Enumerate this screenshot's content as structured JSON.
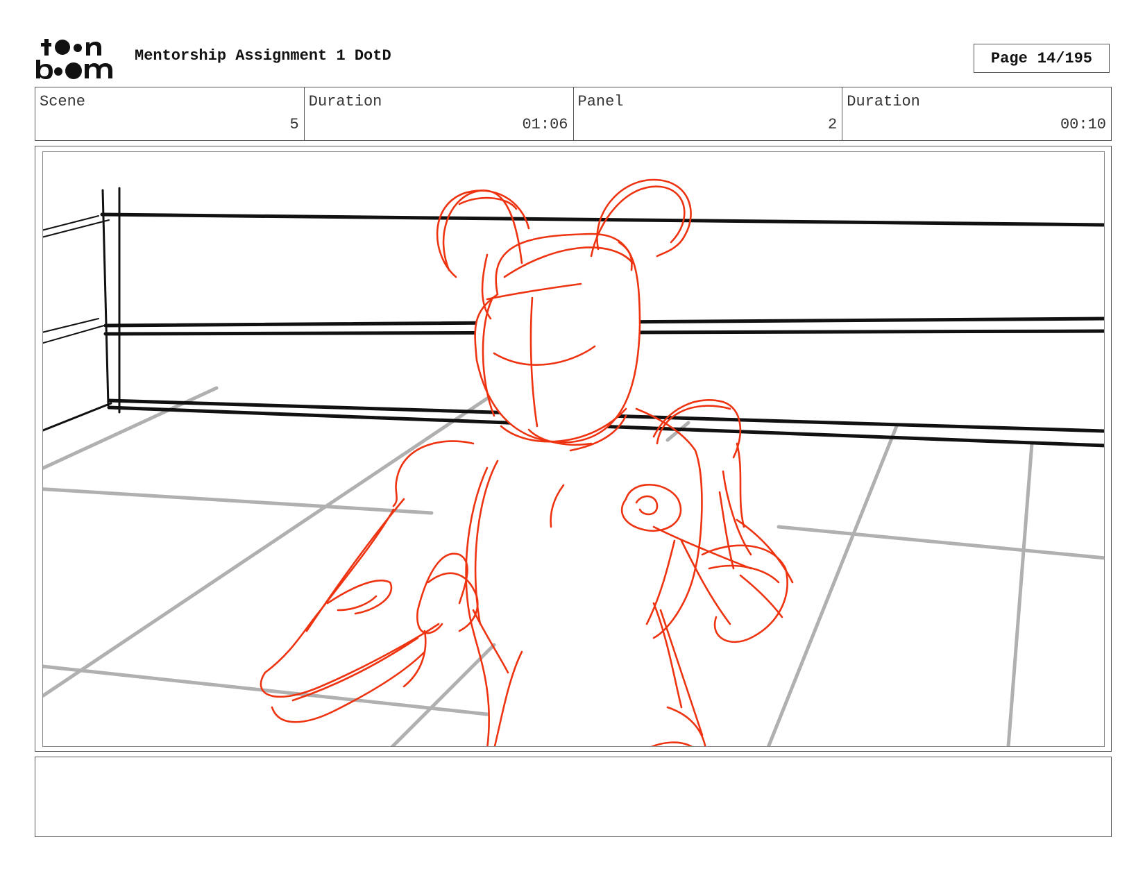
{
  "header": {
    "logo": {
      "line1": "toon",
      "line2": "boom"
    },
    "title": "Mentorship Assignment 1 DotD",
    "page_label": "Page",
    "page_value": "14/195"
  },
  "info": {
    "scene_label": "Scene",
    "scene_value": "5",
    "scene_duration_label": "Duration",
    "scene_duration_value": "01:06",
    "panel_label": "Panel",
    "panel_value": "2",
    "panel_duration_label": "Duration",
    "panel_duration_value": "00:10"
  },
  "panel": {
    "sketch_color": "#ee3311",
    "ring_rope_color": "#111111",
    "floor_grid_color": "#b0b0b0"
  },
  "notes": {
    "text": ""
  }
}
